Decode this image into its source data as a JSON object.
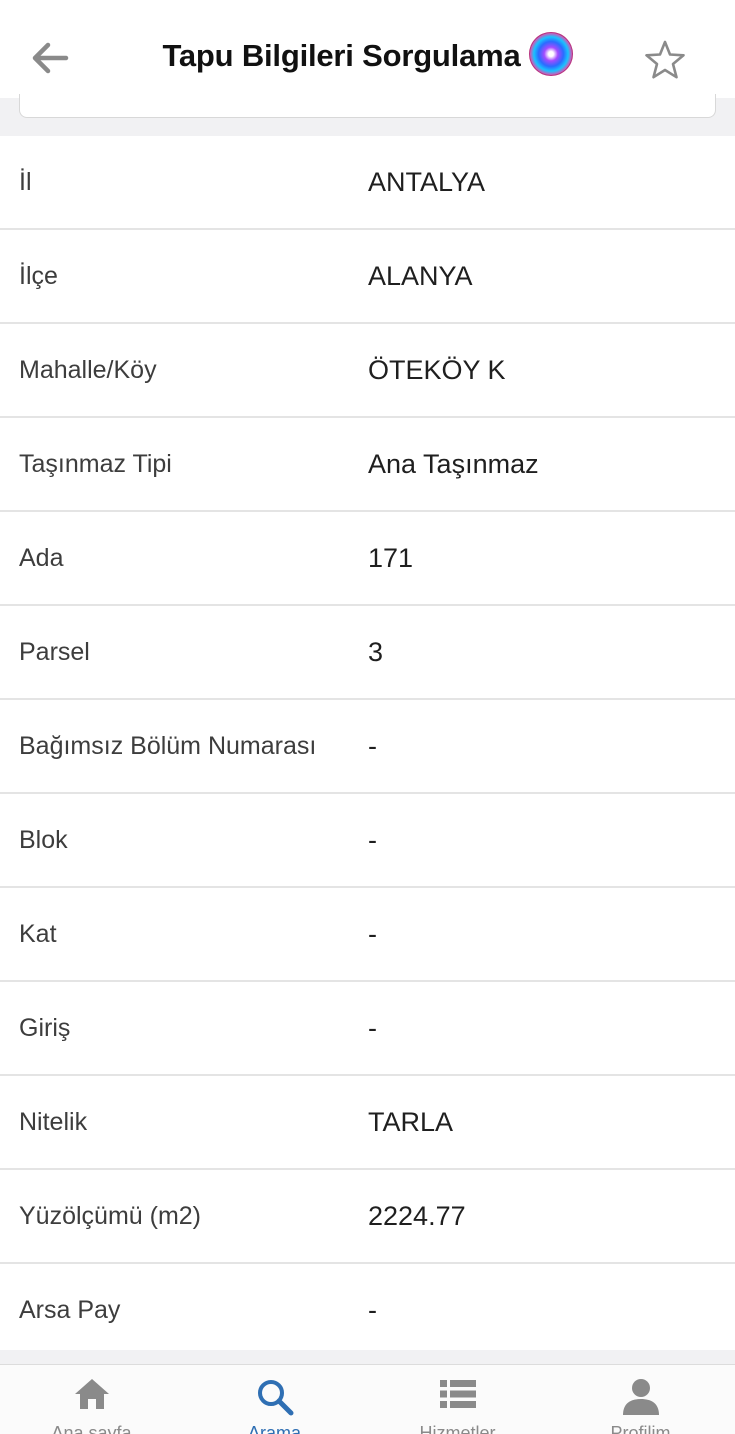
{
  "header": {
    "title": "Tapu Bilgileri Sorgulama",
    "back_icon": "arrow-left-icon",
    "assistant_icon": "siri-icon",
    "favorite_icon": "star-outline-icon"
  },
  "details": [
    {
      "label": "İl",
      "value": "ANTALYA"
    },
    {
      "label": "İlçe",
      "value": "ALANYA"
    },
    {
      "label": "Mahalle/Köy",
      "value": "ÖTEKÖY K"
    },
    {
      "label": "Taşınmaz Tipi",
      "value": "Ana Taşınmaz"
    },
    {
      "label": "Ada",
      "value": "171"
    },
    {
      "label": "Parsel",
      "value": "3"
    },
    {
      "label": "Bağımsız Bölüm Numarası",
      "value": "-"
    },
    {
      "label": "Blok",
      "value": "-"
    },
    {
      "label": "Kat",
      "value": "-"
    },
    {
      "label": "Giriş",
      "value": "-"
    },
    {
      "label": "Nitelik",
      "value": "TARLA"
    },
    {
      "label": "Yüzölçümü (m2)",
      "value": "2224.77"
    },
    {
      "label": "Arsa Pay",
      "value": "-"
    }
  ],
  "tabbar": {
    "items": [
      {
        "label": "Ana sayfa",
        "icon": "home-icon",
        "active": false
      },
      {
        "label": "Arama",
        "icon": "search-icon",
        "active": true
      },
      {
        "label": "Hizmetler",
        "icon": "list-icon",
        "active": false
      },
      {
        "label": "Profilim",
        "icon": "person-icon",
        "active": false
      }
    ]
  },
  "colors": {
    "accent": "#2f6fb3",
    "icon_gray": "#8a8a8a",
    "divider": "#e4e4e4"
  }
}
